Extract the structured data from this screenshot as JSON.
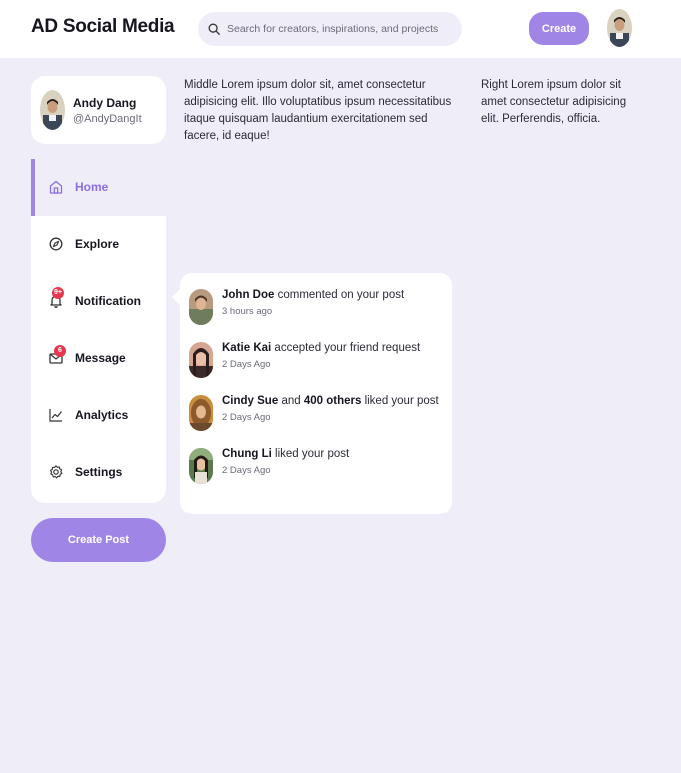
{
  "header": {
    "logo": "AD Social Media",
    "search": {
      "placeholder": "Search for creators, inspirations, and projects"
    },
    "create_label": "Create",
    "avatar_icon": "user-avatar"
  },
  "profile": {
    "name": "Andy Dang",
    "handle": "@AndyDangIt"
  },
  "sidebar": {
    "items": [
      {
        "label": "Home",
        "icon": "home-icon"
      },
      {
        "label": "Explore",
        "icon": "compass-icon"
      },
      {
        "label": "Notification",
        "icon": "bell-icon",
        "badge": "9+"
      },
      {
        "label": "Message",
        "icon": "envelope-icon",
        "badge": "6"
      },
      {
        "label": "Analytics",
        "icon": "chart-icon"
      },
      {
        "label": "Settings",
        "icon": "gear-icon"
      }
    ],
    "active": "Home",
    "create_post_label": "Create Post"
  },
  "main": {
    "middle_text": "Middle Lorem ipsum dolor sit, amet consectetur adipisicing elit. Illo voluptatibus ipsum necessitatibus itaque quisquam laudantium exercitationem sed facere, id eaque!",
    "right_text": "Right Lorem ipsum dolor sit amet consectetur adipisicing elit. Perferendis, officia."
  },
  "notifications": [
    {
      "name": "John Doe",
      "text": "commented on your post",
      "time": "3 hours ago"
    },
    {
      "name": "Katie Kai",
      "text": "accepted your friend request",
      "time": "2 Days Ago"
    },
    {
      "name": "Cindy Sue",
      "mid": "and",
      "name2": "400 others",
      "text": "liked your post",
      "time": "2 Days Ago"
    },
    {
      "name": "Chung Li",
      "text": "liked your post",
      "time": "2 Days Ago"
    }
  ],
  "colors": {
    "accent": "#9f86e6",
    "background": "#efedf7",
    "badge": "#e8364f"
  }
}
